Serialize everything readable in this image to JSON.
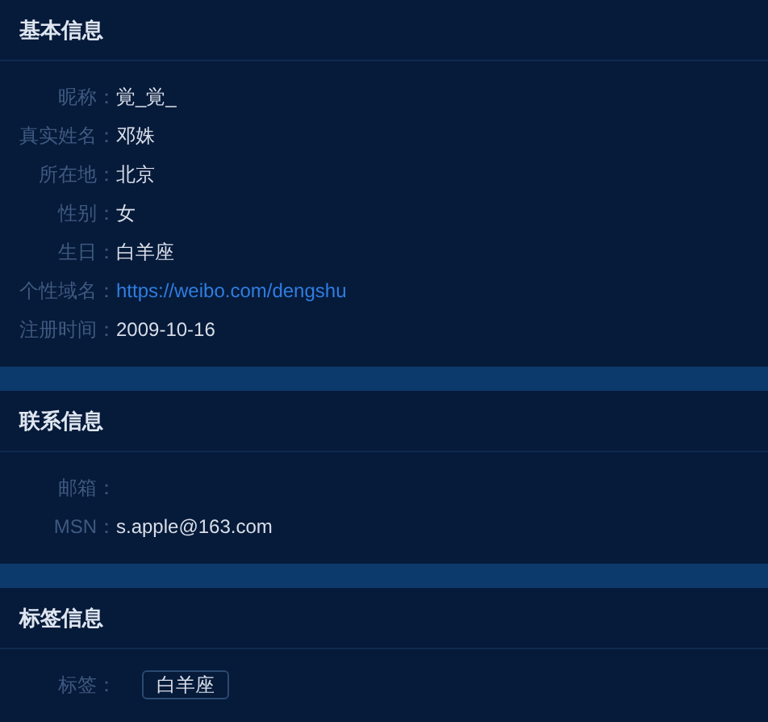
{
  "sections": [
    {
      "title": "基本信息",
      "fields": [
        {
          "label": "昵称：",
          "value": "覚_覚_",
          "kind": "text"
        },
        {
          "label": "真实姓名：",
          "value": "邓姝",
          "kind": "text"
        },
        {
          "label": "所在地：",
          "value": "北京",
          "kind": "text"
        },
        {
          "label": "性别：",
          "value": "女",
          "kind": "text"
        },
        {
          "label": "生日：",
          "value": "白羊座",
          "kind": "text"
        },
        {
          "label": "个性域名：",
          "value": "https://weibo.com/dengshu",
          "kind": "link"
        },
        {
          "label": "注册时间：",
          "value": "2009-10-16",
          "kind": "text"
        }
      ]
    },
    {
      "title": "联系信息",
      "fields": [
        {
          "label": "邮箱：",
          "kind": "empty"
        },
        {
          "label": "MSN：",
          "value": "s.apple@163.com",
          "kind": "text"
        }
      ]
    },
    {
      "title": "标签信息",
      "fields": [
        {
          "label": "标签：",
          "value": "白羊座",
          "kind": "tag"
        }
      ]
    }
  ]
}
